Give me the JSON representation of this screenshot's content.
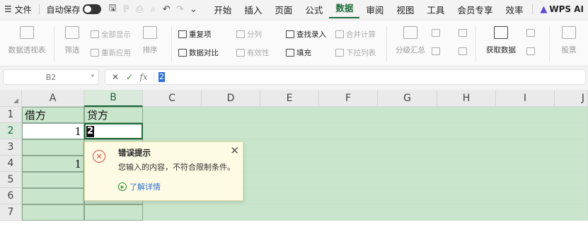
{
  "menubar": {
    "file": "文件",
    "autosave_label": "自动保存",
    "tabs": [
      "开始",
      "插入",
      "页面",
      "公式",
      "数据",
      "审阅",
      "视图",
      "工具",
      "会员专享",
      "效率"
    ],
    "active_tab": "数据",
    "wps_ai": "WPS AI"
  },
  "ribbon": {
    "pivot": "数据透视表",
    "filter": "筛选",
    "show_all": "全部显示",
    "reapply": "重新应用",
    "sort": "排序",
    "duplicates": "重复项",
    "compare": "数据对比",
    "split_col": "分列",
    "validity": "有效性",
    "find_input": "查找录入",
    "fill": "填充",
    "merge_calc": "合并计算",
    "dropdown_list": "下拉列表",
    "subtotal": "分级汇总",
    "get_data": "获取数据",
    "more": "股票"
  },
  "formula_bar": {
    "cell_ref": "B2",
    "cancel": "✕",
    "confirm": "✓",
    "fx": "fx",
    "value": "2"
  },
  "grid": {
    "columns": [
      "A",
      "B",
      "C",
      "D",
      "E",
      "F",
      "G",
      "H",
      "I",
      "J"
    ],
    "rows": [
      "1",
      "2",
      "3",
      "4",
      "5",
      "6",
      "7"
    ],
    "cells": {
      "A1": "借方",
      "B1": "贷方",
      "A2": "1",
      "B2": "2",
      "A4": "1"
    }
  },
  "popup": {
    "title": "错误提示",
    "message": "您输入的内容，不符合限制条件。",
    "link": "了解详情"
  }
}
